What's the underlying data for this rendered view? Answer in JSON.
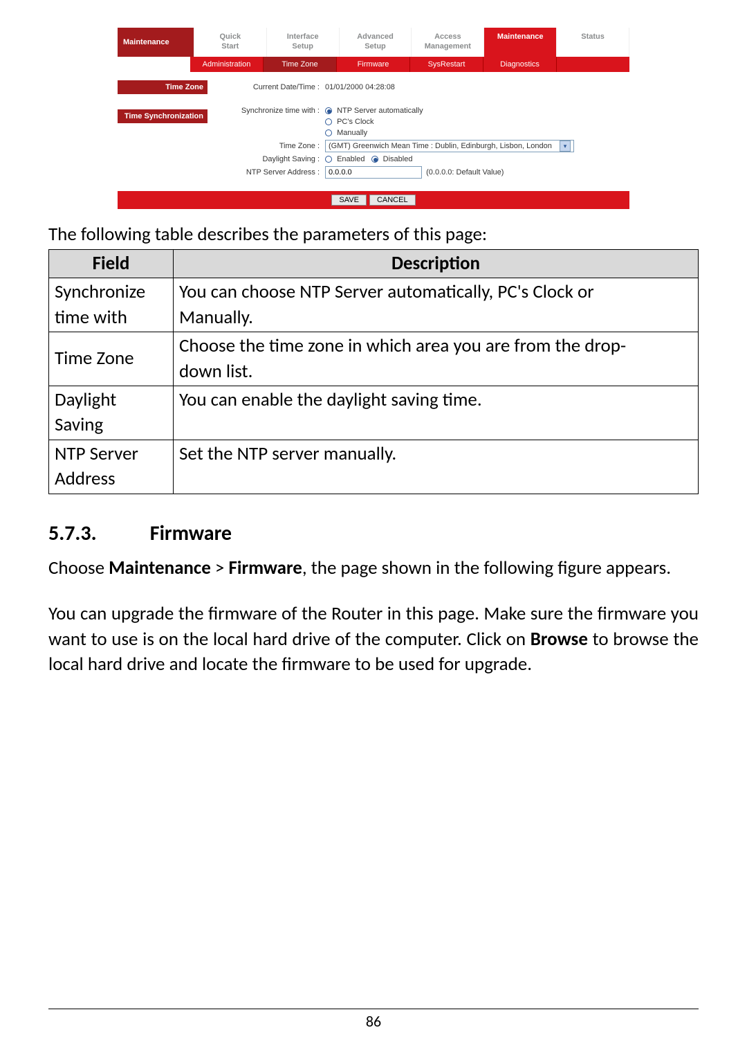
{
  "router": {
    "side_label": "Maintenance",
    "top_tabs": [
      "Quick\nStart",
      "Interface\nSetup",
      "Advanced\nSetup",
      "Access\nManagement",
      "Maintenance",
      "Status"
    ],
    "sub_tabs": [
      "Administration",
      "Time Zone",
      "Firmware",
      "SysRestart",
      "Diagnostics"
    ],
    "side_blocks": [
      "Time Zone",
      "Time Synchronization"
    ],
    "current_dt_label": "Current Date/Time :",
    "current_dt_value": "01/01/2000 04:28:08",
    "sync_label": "Synchronize time with :",
    "sync_opt_ntp": "NTP Server automatically",
    "sync_opt_pc": "PC's Clock",
    "sync_opt_manual": "Manually",
    "tz_label": "Time Zone :",
    "tz_value": "(GMT) Greenwich Mean Time : Dublin, Edinburgh, Lisbon, London",
    "ds_label": "Daylight Saving :",
    "ds_enabled": "Enabled",
    "ds_disabled": "Disabled",
    "ntp_label": "NTP Server Address :",
    "ntp_value": "0.0.0.0",
    "ntp_hint": "(0.0.0.0: Default Value)",
    "btn_save": "SAVE",
    "btn_cancel": "CANCEL"
  },
  "intro": "The following table describes the parameters of this page:",
  "table": {
    "head_field": "Field",
    "head_desc": "Description",
    "rows": [
      {
        "field1": "Synchronize",
        "field2": "time with",
        "desc1": "You can choose NTP Server automatically, PC's Clock or",
        "desc2": "Manually."
      },
      {
        "field1": "Time Zone",
        "field2": "",
        "desc1": "Choose the time zone in which area you are from the drop-",
        "desc2": "down list."
      },
      {
        "field1": "Daylight",
        "field2": "Saving",
        "desc1": "You can enable the daylight saving time.",
        "desc2": ""
      },
      {
        "field1": "NTP Server",
        "field2": "Address",
        "desc1": "Set the NTP server manually.",
        "desc2": ""
      }
    ]
  },
  "section": {
    "num": "5.7.3.",
    "title": "Firmware"
  },
  "para1_a": "Choose ",
  "para1_b": "Maintenance",
  "para1_c": " > ",
  "para1_d": "Firmware",
  "para1_e": ", the page shown in the following figure appears.",
  "para2_a": "You can upgrade the firmware of the Router in this page. Make sure the firmware you want to use is on the local hard drive of the computer. Click on ",
  "para2_b": "Browse",
  "para2_c": " to browse the local hard drive and locate the firmware to be used for upgrade.",
  "page_number": "86"
}
